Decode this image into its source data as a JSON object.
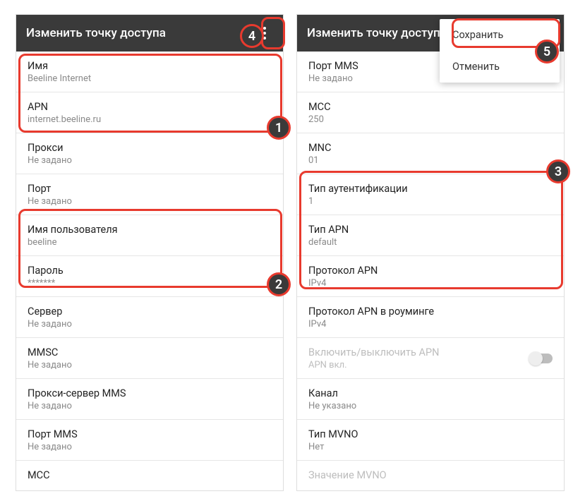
{
  "left": {
    "title": "Изменить точку доступа",
    "items": [
      {
        "label": "Имя",
        "value": "Beeline Internet"
      },
      {
        "label": "APN",
        "value": "internet.beeline.ru"
      },
      {
        "label": "Прокси",
        "value": "Не задано"
      },
      {
        "label": "Порт",
        "value": "Не задано"
      },
      {
        "label": "Имя пользователя",
        "value": "beeline"
      },
      {
        "label": "Пароль",
        "value": "*******"
      },
      {
        "label": "Сервер",
        "value": "Не задано"
      },
      {
        "label": "MMSC",
        "value": "Не задано"
      },
      {
        "label": "Прокси-сервер MMS",
        "value": "Не задано"
      },
      {
        "label": "Порт MMS",
        "value": "Не задано"
      },
      {
        "label": "MCC",
        "value": ""
      }
    ]
  },
  "right": {
    "title": "Изменить точку доступа",
    "popup": {
      "save": "Сохранить",
      "cancel": "Отменить"
    },
    "items": [
      {
        "label": "Порт MMS",
        "value": "Не задано"
      },
      {
        "label": "MCC",
        "value": "250"
      },
      {
        "label": "MNC",
        "value": "01"
      },
      {
        "label": "Тип аутентификации",
        "value": "1"
      },
      {
        "label": "Тип APN",
        "value": "default"
      },
      {
        "label": "Протокол APN",
        "value": "IPv4"
      },
      {
        "label": "Протокол APN в роуминге",
        "value": "IPv4"
      },
      {
        "label": "Включить/выключить APN",
        "value": "APN вкл.",
        "toggle": true,
        "disabled": true
      },
      {
        "label": "Канал",
        "value": "Не указано"
      },
      {
        "label": "Тип MVNO",
        "value": "Нет"
      },
      {
        "label": "Значение MVNO",
        "value": "",
        "disabled": true
      }
    ]
  },
  "callouts": {
    "1": "1",
    "2": "2",
    "3": "3",
    "4": "4",
    "5": "5"
  }
}
